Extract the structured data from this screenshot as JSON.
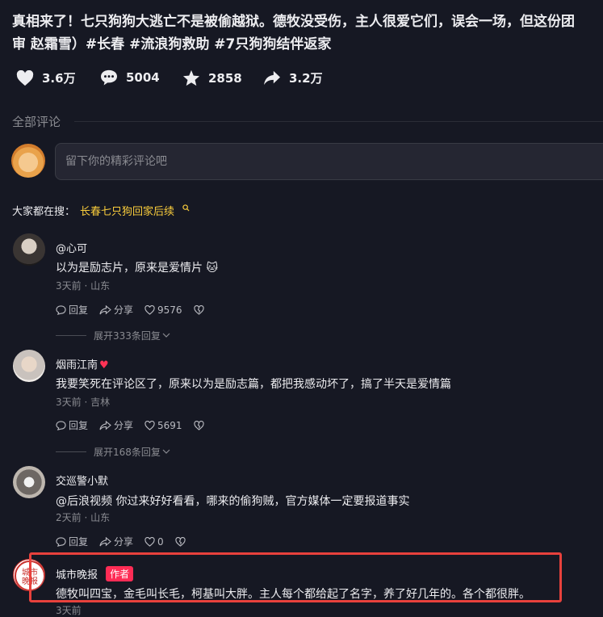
{
  "video": {
    "title_line1": "真相来了！七只狗狗大逃亡不是被偷越狱。德牧没受伤，主人很爱它们，误会一场，但这份团",
    "title_line2": "审 赵霜雪）#长春 #流浪狗救助 #7只狗狗结伴返家"
  },
  "stats": {
    "likes": "3.6万",
    "comments": "5004",
    "favorites": "2858",
    "shares": "3.2万"
  },
  "comments_section": {
    "label": "全部评论",
    "input_placeholder": "留下你的精彩评论吧"
  },
  "search": {
    "prefix": "大家都在搜：",
    "query": "长春七只狗回家后续"
  },
  "comments": [
    {
      "user": "@心可",
      "text": "以为是励志片，原来是爱情片 🐱",
      "meta": "3天前 · 山东",
      "reply": "回复",
      "share": "分享",
      "likes": "9576",
      "expand": "展开333条回复"
    },
    {
      "user": "烟雨江南",
      "heart_emoji": "♥",
      "text": "我要笑死在评论区了，原来以为是励志篇，都把我感动坏了，搞了半天是爱情篇",
      "meta": "3天前 · 吉林",
      "reply": "回复",
      "share": "分享",
      "likes": "5691",
      "expand": "展开168条回复"
    },
    {
      "user": "交巡警小默",
      "text": "@后浪视频 你过来好好看看，哪来的偷狗贼，官方媒体一定要报道事实",
      "meta": "2天前 · 山东",
      "reply": "回复",
      "share": "分享",
      "likes": "0"
    },
    {
      "user": "城市晚报",
      "badge": "作者",
      "logo_text": "城市晚报",
      "text": "德牧叫四宝，金毛叫长毛，柯基叫大胖。主人每个都给起了名字，养了好几年的。各个都很胖。",
      "meta": "3天前"
    }
  ],
  "colors": {
    "background": "#161823",
    "search_link": "#facd3c",
    "author_badge": "#fe2c55",
    "highlight_box": "#e8413c"
  }
}
